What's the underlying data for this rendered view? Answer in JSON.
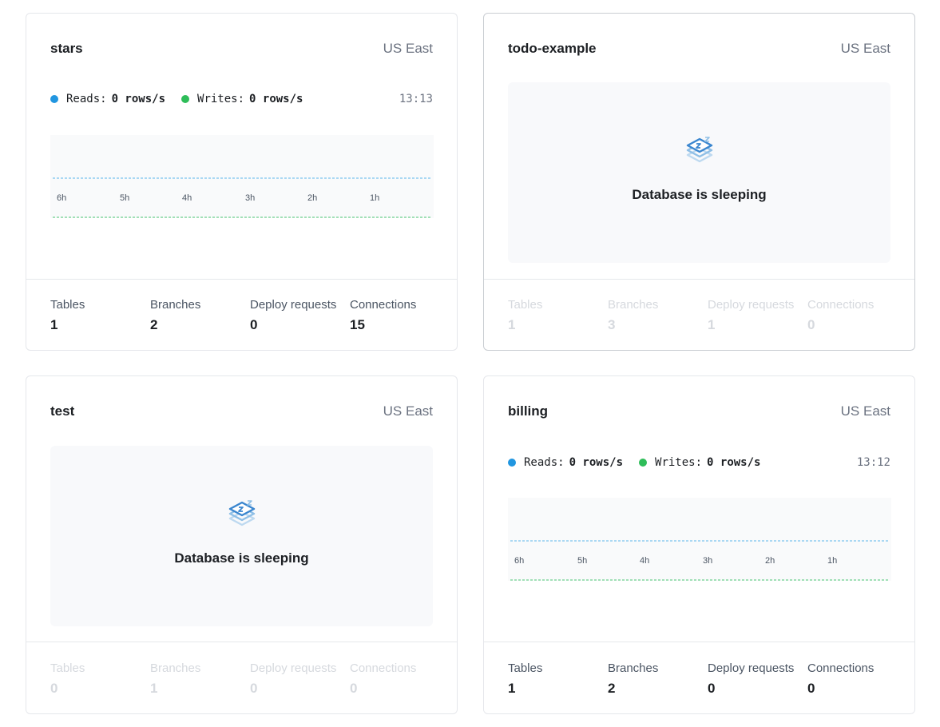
{
  "colors": {
    "reads": "#2196e0",
    "writes": "#2ebd59"
  },
  "x_ticks": [
    "6h",
    "5h",
    "4h",
    "3h",
    "2h",
    "1h"
  ],
  "sleeping_text": "Database is sleeping",
  "stat_labels": {
    "tables": "Tables",
    "branches": "Branches",
    "deploy": "Deploy requests",
    "connections": "Connections"
  },
  "databases": [
    {
      "name": "stars",
      "region": "US East",
      "reads_label": "Reads:",
      "reads_value": "0 rows/s",
      "writes_label": "Writes:",
      "writes_value": "0 rows/s",
      "time": "13:13",
      "stats": {
        "tables": "1",
        "branches": "2",
        "deploy": "0",
        "connections": "15"
      }
    },
    {
      "name": "todo-example",
      "region": "US East",
      "stats": {
        "tables": "1",
        "branches": "3",
        "deploy": "1",
        "connections": "0"
      }
    },
    {
      "name": "test",
      "region": "US East",
      "stats": {
        "tables": "0",
        "branches": "1",
        "deploy": "0",
        "connections": "0"
      }
    },
    {
      "name": "billing",
      "region": "US East",
      "reads_label": "Reads:",
      "reads_value": "0 rows/s",
      "writes_label": "Writes:",
      "writes_value": "0 rows/s",
      "time": "13:12",
      "stats": {
        "tables": "1",
        "branches": "2",
        "deploy": "0",
        "connections": "0"
      }
    }
  ]
}
